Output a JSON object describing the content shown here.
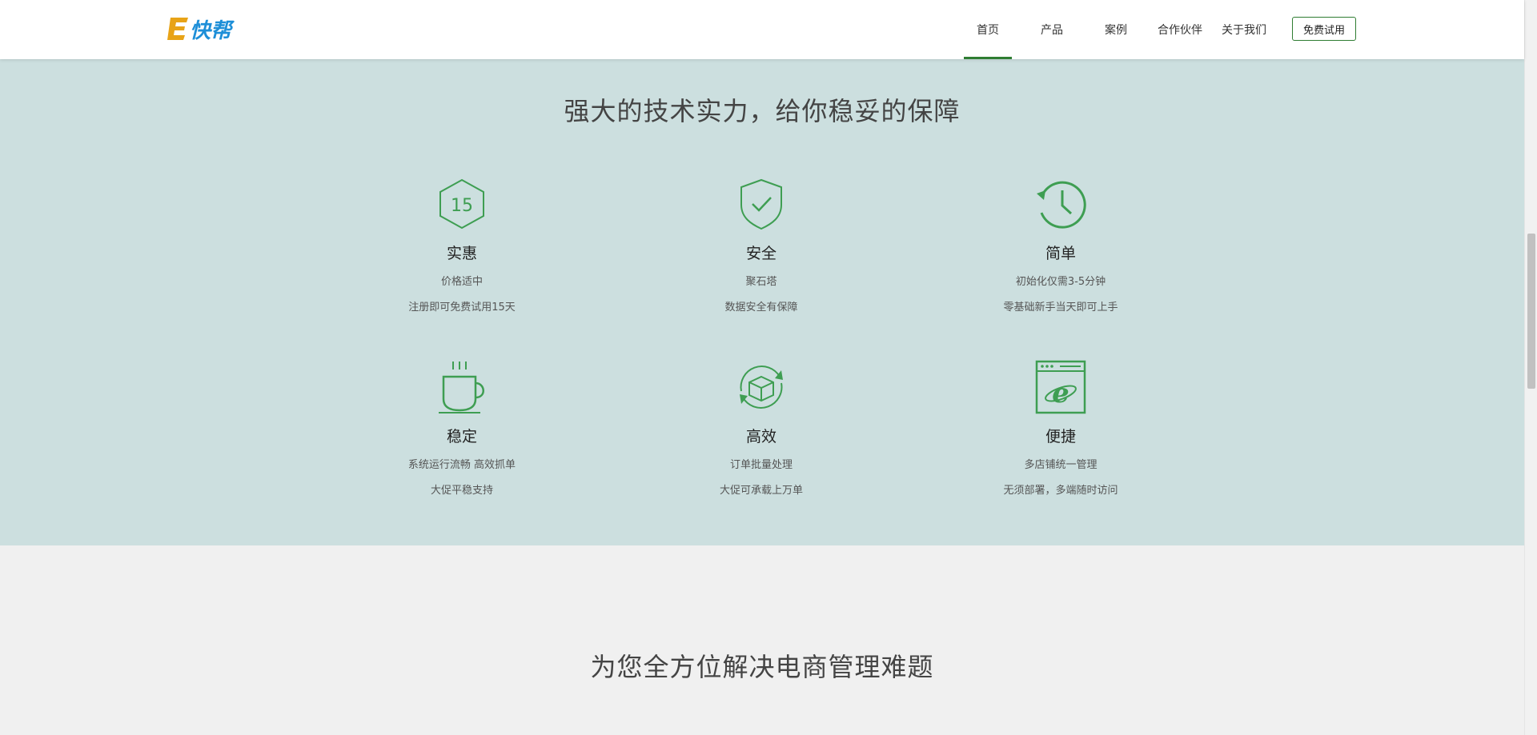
{
  "brand": {
    "logo_text": "E快帮"
  },
  "nav": {
    "items": [
      {
        "label": "首页",
        "active": true
      },
      {
        "label": "产品",
        "active": false
      },
      {
        "label": "案例",
        "active": false
      },
      {
        "label": "合作伙伴",
        "active": false
      },
      {
        "label": "关于我们",
        "active": false
      }
    ],
    "cta_label": "免费试用"
  },
  "features": {
    "title": "强大的技术实力，给你稳妥的保障",
    "items": [
      {
        "icon": "hexagon-15-icon",
        "icon_text": "15",
        "name": "实惠",
        "lines": [
          "价格适中",
          "注册即可免费试用15天"
        ]
      },
      {
        "icon": "shield-check-icon",
        "name": "安全",
        "lines": [
          "聚石塔",
          "数据安全有保障"
        ]
      },
      {
        "icon": "clock-history-icon",
        "name": "简单",
        "lines": [
          "初始化仅需3-5分钟",
          "零基础新手当天即可上手"
        ]
      },
      {
        "icon": "coffee-cup-icon",
        "name": "稳定",
        "lines": [
          "系统运行流畅 高效抓单",
          "大促平稳支持"
        ]
      },
      {
        "icon": "box-cycle-icon",
        "name": "高效",
        "lines": [
          "订单批量处理",
          "大促可承载上万单"
        ]
      },
      {
        "icon": "browser-ie-icon",
        "name": "便捷",
        "lines": [
          "多店铺统一管理",
          "无须部署，多端随时访问"
        ]
      }
    ]
  },
  "section2": {
    "title": "为您全方位解决电商管理难题"
  },
  "colors": {
    "accent": "#2f7d32",
    "icon_green": "#3e9e52",
    "features_bg": "#ccdfdf",
    "page_bg": "#f0f0f0"
  }
}
